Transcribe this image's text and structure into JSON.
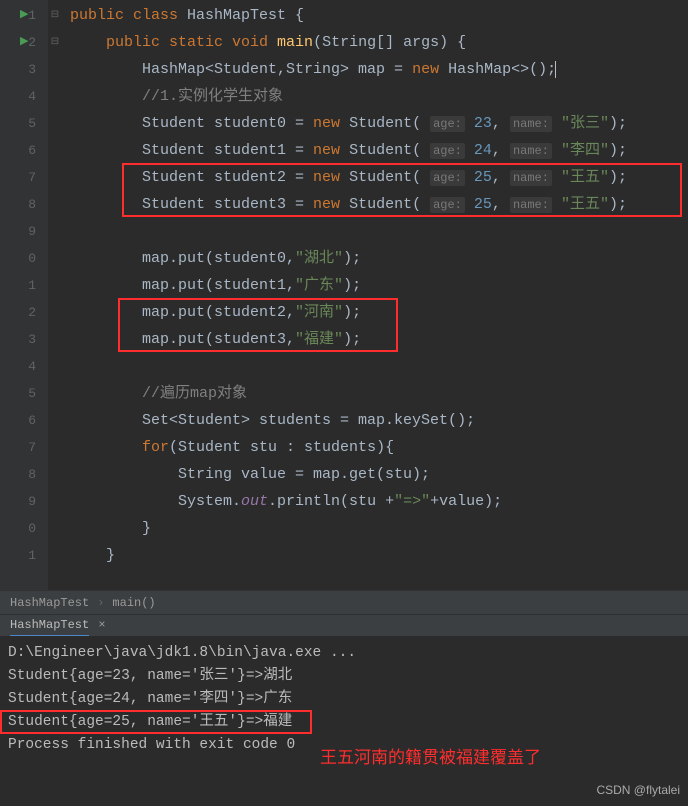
{
  "gutter": [
    "1",
    "2",
    "3",
    "4",
    "5",
    "6",
    "7",
    "8",
    "9",
    "0",
    "1",
    "2",
    "3",
    "4",
    "5",
    "6",
    "7",
    "8",
    "9",
    "0",
    "1"
  ],
  "code": {
    "l1": "public class HashMapTest {",
    "l2": "    public static void main(String[] args) {",
    "l3_a": "        HashMap<Student,String> map = ",
    "l3_b": " HashMap<>();",
    "l4": "        //1.实例化学生对象",
    "l5_a": "        Student student0 = ",
    "l5_b": " Student( ",
    "l5_age": "age:",
    "l5_num": "23",
    "l5_c": ", ",
    "l5_name": "name:",
    "l5_str": "\"张三\"",
    "l5_d": ");",
    "l6_num": "24",
    "l6_str": "\"李四\"",
    "l7_num": "25",
    "l7_str": "\"王五\"",
    "l8_num": "25",
    "l8_str": "\"王五\"",
    "l10": "        map.put(student0,",
    "l10_str": "\"湖北\"",
    "l11": "        map.put(student1,",
    "l11_str": "\"广东\"",
    "l12": "        map.put(student2,",
    "l12_str": "\"河南\"",
    "l13": "        map.put(student3,",
    "l13_str": "\"福建\"",
    "put_end": ");",
    "l15": "        //遍历map对象",
    "l16": "        Set<Student> students = map.keySet();",
    "l17": "        for(Student stu : students){",
    "l18": "            String value = map.get(stu);",
    "l19_a": "            System.",
    "l19_out": "out",
    "l19_b": ".println(stu +",
    "l19_str": "\"=>\"",
    "l19_c": "+value);",
    "l20": "        }",
    "l21": "    }",
    "new": "new",
    "st1": "        Student student1 = ",
    "st2": "        Student student2 = ",
    "st3": "        Student student3 = "
  },
  "breadcrumb": {
    "a": "HashMapTest",
    "b": "main()"
  },
  "tab": "HashMapTest",
  "console": {
    "l1": "D:\\Engineer\\java\\jdk1.8\\bin\\java.exe ...",
    "l2": "Student{age=23, name='张三'}=>湖北",
    "l3": "Student{age=24, name='李四'}=>广东",
    "l4": "Student{age=25, name='王五'}=>福建",
    "l5": "",
    "l6": "Process finished with exit code 0"
  },
  "annotation": "王五河南的籍贯被福建覆盖了",
  "watermark": "CSDN @flytalei"
}
